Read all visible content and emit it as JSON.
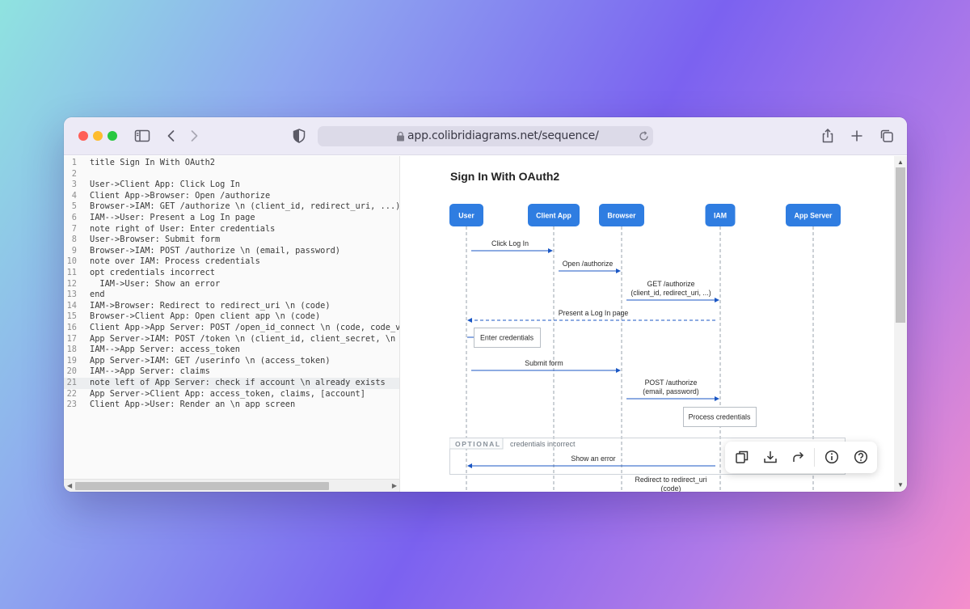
{
  "browser": {
    "url": "app.colibridiagrams.net/sequence/"
  },
  "editor": {
    "active_line": 21,
    "lines": [
      "title Sign In With OAuth2",
      "",
      "User->Client App: Click Log In",
      "Client App->Browser: Open /authorize",
      "Browser->IAM: GET /authorize \\n (client_id, redirect_uri, ...)",
      "IAM-->User: Present a Log In page",
      "note right of User: Enter credentials",
      "User->Browser: Submit form",
      "Browser->IAM: POST /authorize \\n (email, password)",
      "note over IAM: Process credentials",
      "opt credentials incorrect",
      "  IAM->User: Show an error",
      "end",
      "IAM->Browser: Redirect to redirect_uri \\n (code)",
      "Browser->Client App: Open client app \\n (code)",
      "Client App->App Server: POST /open_id_connect \\n (code, code_verif",
      "App Server->IAM: POST /token \\n (client_id, client_secret, \\n code",
      "IAM-->App Server: access_token",
      "App Server->IAM: GET /userinfo \\n (access_token)",
      "IAM-->App Server: claims",
      "note left of App Server: check if account \\n already exists",
      "App Server->Client App: access_token, claims, [account]",
      "Client App->User: Render an \\n app screen"
    ]
  },
  "diagram": {
    "title": "Sign In With OAuth2",
    "actors": [
      "User",
      "Client App",
      "Browser",
      "IAM",
      "App Server"
    ],
    "messages": [
      {
        "lines": [
          "Click Log In"
        ],
        "from": 0,
        "to": 1,
        "dashed": false
      },
      {
        "lines": [
          "Open /authorize"
        ],
        "from": 1,
        "to": 2,
        "dashed": false
      },
      {
        "lines": [
          "GET /authorize",
          "(client_id, redirect_uri, ...)"
        ],
        "from": 2,
        "to": 3,
        "dashed": false
      },
      {
        "lines": [
          "Present a Log In page"
        ],
        "from": 3,
        "to": 0,
        "dashed": true
      },
      {
        "lines": [
          "Submit form"
        ],
        "from": 0,
        "to": 2,
        "dashed": false
      },
      {
        "lines": [
          "POST /authorize",
          "(email, password)"
        ],
        "from": 2,
        "to": 3,
        "dashed": false
      },
      {
        "lines": [
          "Show an error"
        ],
        "from": 3,
        "to": 0,
        "dashed": false
      },
      {
        "lines": [
          "Redirect to redirect_uri",
          "(code)"
        ],
        "from": 3,
        "to": 2,
        "dashed": false
      }
    ],
    "notes": [
      {
        "text": "Enter credentials"
      },
      {
        "text": "Process credentials"
      }
    ],
    "fragment": {
      "keyword": "OPTIONAL",
      "condition": "credentials incorrect"
    },
    "colors": {
      "actor": "#2f7de1",
      "arrow": "#1b57c4",
      "lifeline": "#9aa3ad"
    }
  },
  "toolbar": {
    "icons": [
      "copy-icon",
      "download-icon",
      "share-icon",
      "info-icon",
      "help-icon"
    ]
  }
}
